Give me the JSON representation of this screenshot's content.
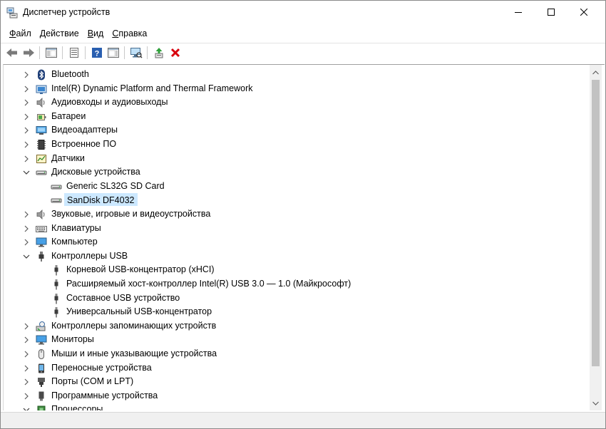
{
  "window": {
    "title": "Диспетчер устройств",
    "icons": {
      "app": "device-manager-icon",
      "minimize": "minimize-icon",
      "maximize": "maximize-icon",
      "close": "close-icon"
    }
  },
  "menu": [
    {
      "label": "Файл",
      "accel": "Ф",
      "rest": "айл"
    },
    {
      "label": "Действие",
      "accel": "Д",
      "rest": "ействие"
    },
    {
      "label": "Вид",
      "accel": "В",
      "rest": "ид"
    },
    {
      "label": "Справка",
      "accel": "С",
      "rest": "правка"
    }
  ],
  "toolbar": {
    "buttons": [
      "back-arrow-icon",
      "forward-arrow-icon",
      "show-hide-tree-icon",
      "properties-icon",
      "help-icon",
      "action-pane-icon",
      "scan-hardware-icon",
      "update-driver-icon",
      "uninstall-device-icon"
    ]
  },
  "tree": {
    "items": [
      {
        "label": "Bluetooth",
        "level": 0,
        "state": "collapsed",
        "icon": "bluetooth-icon"
      },
      {
        "label": "Intel(R) Dynamic Platform and Thermal Framework",
        "level": 0,
        "state": "collapsed",
        "icon": "intel-dptf-icon"
      },
      {
        "label": "Аудиовходы и аудиовыходы",
        "level": 0,
        "state": "collapsed",
        "icon": "speaker-icon"
      },
      {
        "label": "Батареи",
        "level": 0,
        "state": "collapsed",
        "icon": "battery-icon"
      },
      {
        "label": "Видеоадаптеры",
        "level": 0,
        "state": "collapsed",
        "icon": "display-adapter-icon"
      },
      {
        "label": "Встроенное ПО",
        "level": 0,
        "state": "collapsed",
        "icon": "firmware-icon"
      },
      {
        "label": "Датчики",
        "level": 0,
        "state": "collapsed",
        "icon": "sensor-icon"
      },
      {
        "label": "Дисковые устройства",
        "level": 0,
        "state": "expanded",
        "icon": "disk-drive-icon"
      },
      {
        "label": "Generic SL32G SD Card",
        "level": 1,
        "state": "leaf",
        "icon": "disk-drive-icon"
      },
      {
        "label": "SanDisk DF4032",
        "level": 1,
        "state": "leaf",
        "icon": "disk-drive-icon",
        "selected": true
      },
      {
        "label": "Звуковые, игровые и видеоустройства",
        "level": 0,
        "state": "collapsed",
        "icon": "speaker-icon"
      },
      {
        "label": "Клавиатуры",
        "level": 0,
        "state": "collapsed",
        "icon": "keyboard-icon"
      },
      {
        "label": "Компьютер",
        "level": 0,
        "state": "collapsed",
        "icon": "computer-icon"
      },
      {
        "label": "Контроллеры USB",
        "level": 0,
        "state": "expanded",
        "icon": "usb-icon"
      },
      {
        "label": "Корневой USB-концентратор (xHCI)",
        "level": 1,
        "state": "leaf",
        "icon": "usb-plug-icon"
      },
      {
        "label": "Расширяемый хост-контроллер Intel(R) USB 3.0 — 1.0 (Майкрософт)",
        "level": 1,
        "state": "leaf",
        "icon": "usb-plug-icon"
      },
      {
        "label": "Составное USB устройство",
        "level": 1,
        "state": "leaf",
        "icon": "usb-plug-icon"
      },
      {
        "label": "Универсальный USB-концентратор",
        "level": 1,
        "state": "leaf",
        "icon": "usb-plug-icon"
      },
      {
        "label": "Контроллеры запоминающих устройств",
        "level": 0,
        "state": "collapsed",
        "icon": "storage-controller-icon"
      },
      {
        "label": "Мониторы",
        "level": 0,
        "state": "collapsed",
        "icon": "monitor-icon"
      },
      {
        "label": "Мыши и иные указывающие устройства",
        "level": 0,
        "state": "collapsed",
        "icon": "mouse-icon"
      },
      {
        "label": "Переносные устройства",
        "level": 0,
        "state": "collapsed",
        "icon": "portable-device-icon"
      },
      {
        "label": "Порты (COM и LPT)",
        "level": 0,
        "state": "collapsed",
        "icon": "port-icon"
      },
      {
        "label": "Программные устройства",
        "level": 0,
        "state": "collapsed",
        "icon": "software-device-icon"
      },
      {
        "label": "Процессоры",
        "level": 0,
        "state": "expanded",
        "icon": "processor-icon"
      }
    ]
  },
  "colors": {
    "selection": "#cce8ff",
    "close_red": "#e81123",
    "uninstall_red": "#d8000c",
    "scrollbar_thumb": "#c2c2c2"
  }
}
